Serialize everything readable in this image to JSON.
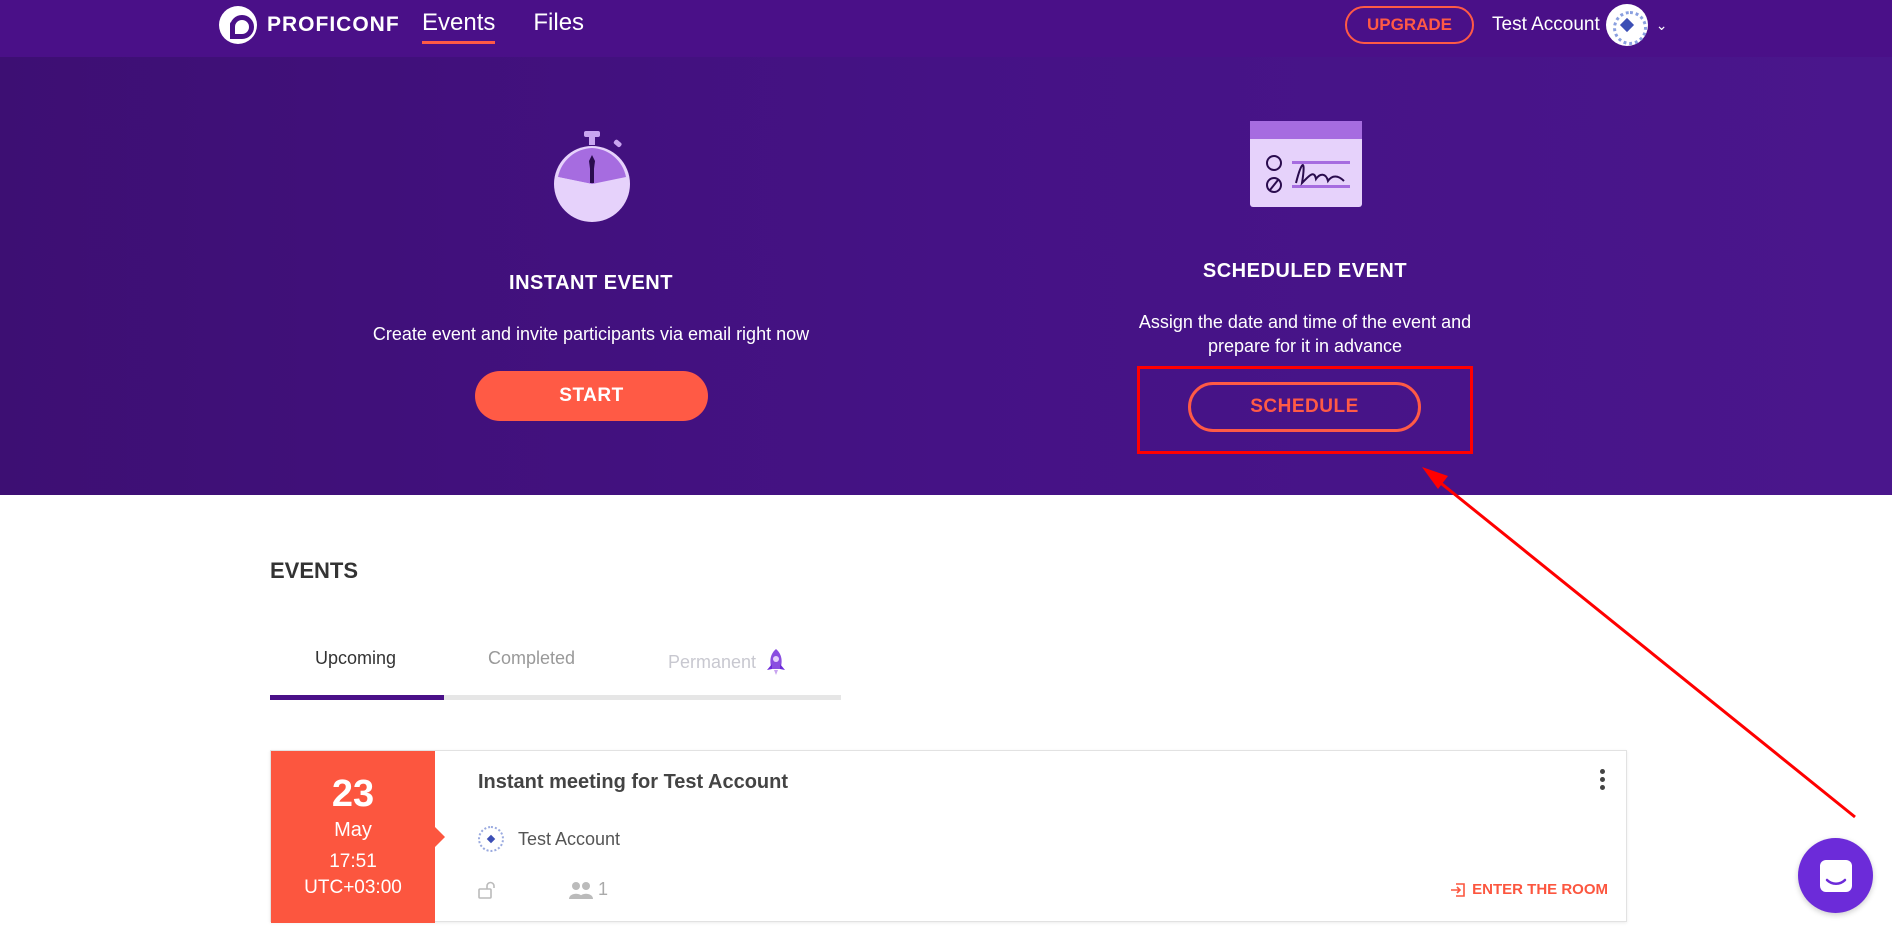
{
  "header": {
    "logo_text": "PROFICONF",
    "nav": [
      {
        "label": "Events",
        "active": true
      },
      {
        "label": "Files",
        "active": false
      }
    ],
    "upgrade_label": "UPGRADE",
    "account_name": "Test Account"
  },
  "hero": {
    "instant": {
      "title": "INSTANT EVENT",
      "description": "Create event and invite participants via email right now",
      "button": "START",
      "icon": "stopwatch-icon"
    },
    "scheduled": {
      "title": "SCHEDULED EVENT",
      "description_line1": "Assign the date and time of the event and",
      "description_line2": "prepare for it in advance",
      "button": "SCHEDULE",
      "icon": "signature-document-icon"
    }
  },
  "events": {
    "heading": "EVENTS",
    "tabs": [
      {
        "label": "Upcoming",
        "active": true
      },
      {
        "label": "Completed",
        "active": false
      },
      {
        "label": "Permanent",
        "active": false,
        "icon": "rocket-icon"
      }
    ],
    "items": [
      {
        "day": "23",
        "month": "May",
        "time": "17:51",
        "timezone": "UTC+03:00",
        "title": "Instant meeting for Test Account",
        "host": "Test Account",
        "participants": "1",
        "enter_label": "ENTER THE ROOM"
      }
    ]
  },
  "colors": {
    "header_bg": "#4a1088",
    "hero_bg": "#451285",
    "accent": "#ff5a45",
    "date_block": "#fc563f",
    "chat_button": "#6c2bd9",
    "annotation": "#ff0000"
  }
}
